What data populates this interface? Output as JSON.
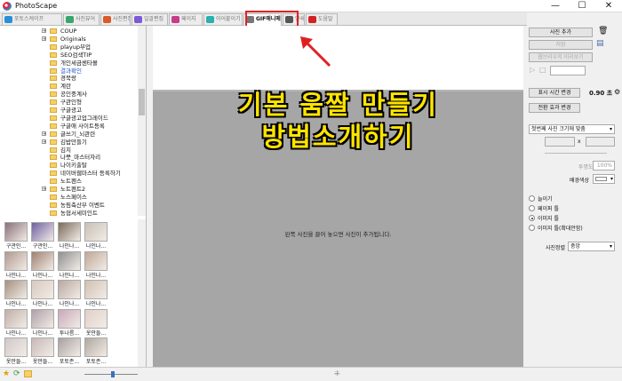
{
  "window": {
    "title": "PhotoScape",
    "minimize": "—",
    "maximize": "☐",
    "close": "✕"
  },
  "tabs": [
    {
      "label": "포토스케이프",
      "color": "#2a8fd8"
    },
    {
      "label": "사진뷰어",
      "color": "#3aa66b"
    },
    {
      "label": "사진편집",
      "color": "#d95b2a"
    },
    {
      "label": "일괄편집",
      "color": "#7b5bd6"
    },
    {
      "label": "페이지",
      "color": "#c83a8a"
    },
    {
      "label": "이어붙이기",
      "color": "#2ab0b0"
    },
    {
      "label": "GIF애니메이션",
      "color": "#777777"
    },
    {
      "label": "인쇄",
      "color": "#555555"
    },
    {
      "label": "도움말",
      "color": "#d22222"
    }
  ],
  "tree": [
    {
      "label": "COUP",
      "exp": "+"
    },
    {
      "label": "Originals",
      "exp": "+"
    },
    {
      "label": "playup부업",
      "exp": ""
    },
    {
      "label": "SEO검색TIP",
      "exp": ""
    },
    {
      "label": "개인세금센타몰",
      "exp": ""
    },
    {
      "label": "결과확인",
      "exp": "",
      "highlight": true
    },
    {
      "label": "경북랑",
      "exp": ""
    },
    {
      "label": "계란",
      "exp": ""
    },
    {
      "label": "공인중계사",
      "exp": ""
    },
    {
      "label": "구관인형",
      "exp": ""
    },
    {
      "label": "구글광고",
      "exp": ""
    },
    {
      "label": "구글광고업그레이드",
      "exp": ""
    },
    {
      "label": "구글애 사이트등록",
      "exp": ""
    },
    {
      "label": "글쓰기_뇌관련",
      "exp": "+"
    },
    {
      "label": "김밥만들기",
      "exp": "+"
    },
    {
      "label": "김치",
      "exp": ""
    },
    {
      "label": "나뭇_마스터자리",
      "exp": ""
    },
    {
      "label": "나이키출탈",
      "exp": ""
    },
    {
      "label": "네이버웹마스터 등록하기",
      "exp": ""
    },
    {
      "label": "노트펜스",
      "exp": ""
    },
    {
      "label": "노트펜트2",
      "exp": "+"
    },
    {
      "label": "노스페이스",
      "exp": ""
    },
    {
      "label": "농림축산부 이벤트",
      "exp": ""
    },
    {
      "label": "농협서세미인트",
      "exp": ""
    }
  ],
  "thumbs": [
    {
      "cap": "구관인...",
      "c": "#8a6f7a"
    },
    {
      "cap": "구관인...",
      "c": "#6f5fa0"
    },
    {
      "cap": "나인나...",
      "c": "#7a6a5a"
    },
    {
      "cap": "나인나...",
      "c": "#c8c0b8"
    },
    {
      "cap": "나인나...",
      "c": "#b09a90"
    },
    {
      "cap": "나인나...",
      "c": "#a08070"
    },
    {
      "cap": "나인나...",
      "c": "#909090"
    },
    {
      "cap": "나인나...",
      "c": "#c0a898"
    },
    {
      "cap": "나인나...",
      "c": "#a59080"
    },
    {
      "cap": "나인나...",
      "c": "#d8c8c0"
    },
    {
      "cap": "나인나...",
      "c": "#b8a8a0"
    },
    {
      "cap": "나인나...",
      "c": "#d0c0b0"
    },
    {
      "cap": "나인나...",
      "c": "#c0b0a8"
    },
    {
      "cap": "나인나...",
      "c": "#b0a0a8"
    },
    {
      "cap": "투나름...",
      "c": "#c8a8b8"
    },
    {
      "cap": "옷만들...",
      "c": "#e0d0c8"
    },
    {
      "cap": "옷만들...",
      "c": "#d0c8c8"
    },
    {
      "cap": "옷만들...",
      "c": "#c8b8b8"
    },
    {
      "cap": "포토존...",
      "c": "#a8a0a0"
    },
    {
      "cap": "포토존...",
      "c": "#b0a8a0"
    }
  ],
  "center": {
    "drop_text": "왼쪽 사진을 끌어 놓으면 사진이 추가됩니다.",
    "overlay_line1": "기본 움짤 만들기",
    "overlay_line2": "방법소개하기"
  },
  "right": {
    "add_photo": "사진 추가",
    "delete": "지우기",
    "save": "저장",
    "preview": "웹브라우저 미리보기",
    "change_display_time": "표시 시간 변경",
    "display_time": "0.90 초",
    "change_transition": "전환 효과 변경",
    "size_select": "첫번째 사진 크기에 맞춤",
    "x": "x",
    "opacity_label": "투명도",
    "opacity_value": "100%",
    "bg_label": "배경색상",
    "radios": [
      {
        "label": "늘이기",
        "on": false
      },
      {
        "label": "페이퍼 틀",
        "on": false
      },
      {
        "label": "이미지 틀",
        "on": true
      },
      {
        "label": "이미지 틀(확대안함)",
        "on": false
      }
    ],
    "align_label": "사진정렬",
    "align_value": "중앙"
  }
}
